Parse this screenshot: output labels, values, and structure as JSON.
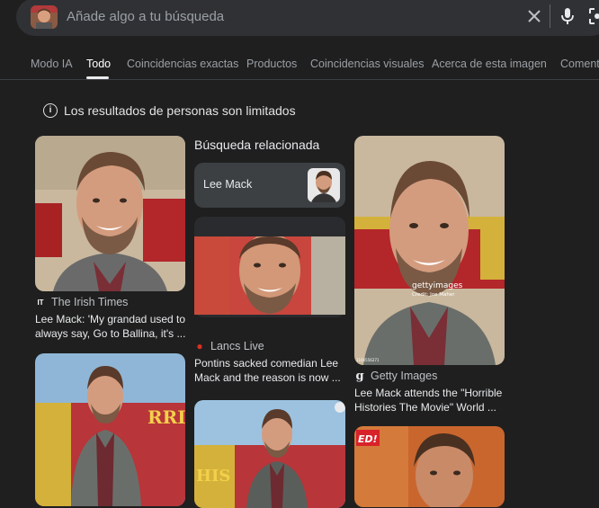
{
  "search": {
    "placeholder": "Añade algo a tu búsqueda"
  },
  "tabs": [
    "Modo IA",
    "Todo",
    "Coincidencias exactas",
    "Productos",
    "Coincidencias visuales",
    "Acerca de esta imagen",
    "Comentar"
  ],
  "active_tab": "Todo",
  "notice": "Los resultados de personas son limitados",
  "related": {
    "title": "Búsqueda relacionada",
    "chip_label": "Lee Mack"
  },
  "results": [
    {
      "source": "The Irish Times",
      "fav": "IT",
      "caption_line1": "Lee Mack: 'My grandad used to",
      "caption_line2": "always say, Go to Ballina, it's ..."
    },
    {
      "source": "Lancs Live",
      "fav": "●",
      "caption_line1": "Pontins sacked comedian Lee",
      "caption_line2": "Mack and the reason is now ..."
    },
    {
      "source": "Getty Images",
      "fav": "g",
      "caption_line1": "Lee Mack attends the \"Horrible",
      "caption_line2": "Histories The Movie\" World ..."
    }
  ],
  "image_text": {
    "getty_watermark": "gettyimages",
    "getty_credit": "Credit: Joe Maher",
    "banner_text": "RRIBLE",
    "banner_text2": "HIS",
    "ed_badge": "ED!",
    "getty_id": "1160556271"
  },
  "colors": {
    "background": "#1f1f1f",
    "search_bg": "#303134",
    "chip_bg": "#3c4043",
    "lancs_red": "#d93025"
  }
}
